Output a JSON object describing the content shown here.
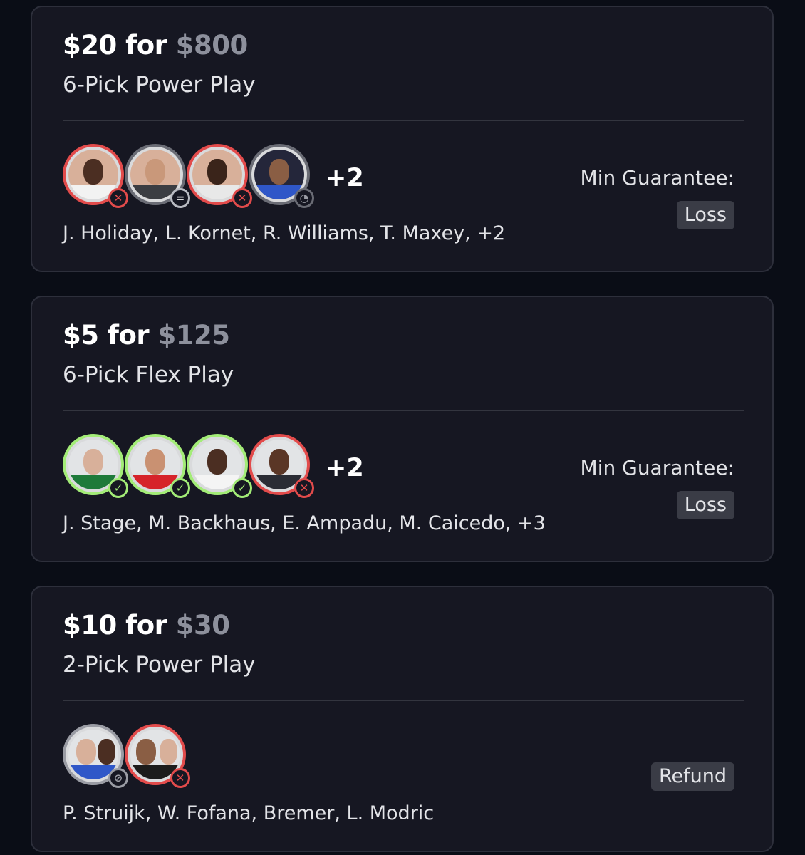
{
  "colors": {
    "background": "#0a0d16",
    "card": "#161722",
    "loss_red": "#e24b4b",
    "win_green": "#a3ec77",
    "muted": "#8d909c"
  },
  "entries": [
    {
      "stake": "$20",
      "for_word": "for",
      "payout": "$800",
      "play_type": "6-Pick Power Play",
      "avatars": [
        {
          "status": "loss",
          "icon": "x-icon"
        },
        {
          "status": "push",
          "icon": "equals-icon"
        },
        {
          "status": "loss",
          "icon": "x-icon"
        },
        {
          "status": "pending",
          "icon": "clock-icon"
        }
      ],
      "more_count": "+2",
      "players": "J. Holiday, L. Kornet, R. Williams, T. Maxey, +2",
      "min_guarantee_label": "Min Guarantee:",
      "result": "Loss"
    },
    {
      "stake": "$5",
      "for_word": "for",
      "payout": "$125",
      "play_type": "6-Pick Flex Play",
      "avatars": [
        {
          "status": "win",
          "icon": "check-icon"
        },
        {
          "status": "win",
          "icon": "check-icon"
        },
        {
          "status": "win",
          "icon": "check-icon"
        },
        {
          "status": "loss",
          "icon": "x-icon"
        }
      ],
      "more_count": "+2",
      "players": "J. Stage, M. Backhaus, E. Ampadu, M. Caicedo, +3",
      "min_guarantee_label": "Min Guarantee:",
      "result": "Loss"
    },
    {
      "stake": "$10",
      "for_word": "for",
      "payout": "$30",
      "play_type": "2-Pick Power Play",
      "avatars": [
        {
          "status": "void",
          "icon": "slash-icon"
        },
        {
          "status": "loss",
          "icon": "x-icon"
        }
      ],
      "players": "P. Struijk, W. Fofana, Bremer, L. Modric",
      "result": "Refund"
    }
  ]
}
